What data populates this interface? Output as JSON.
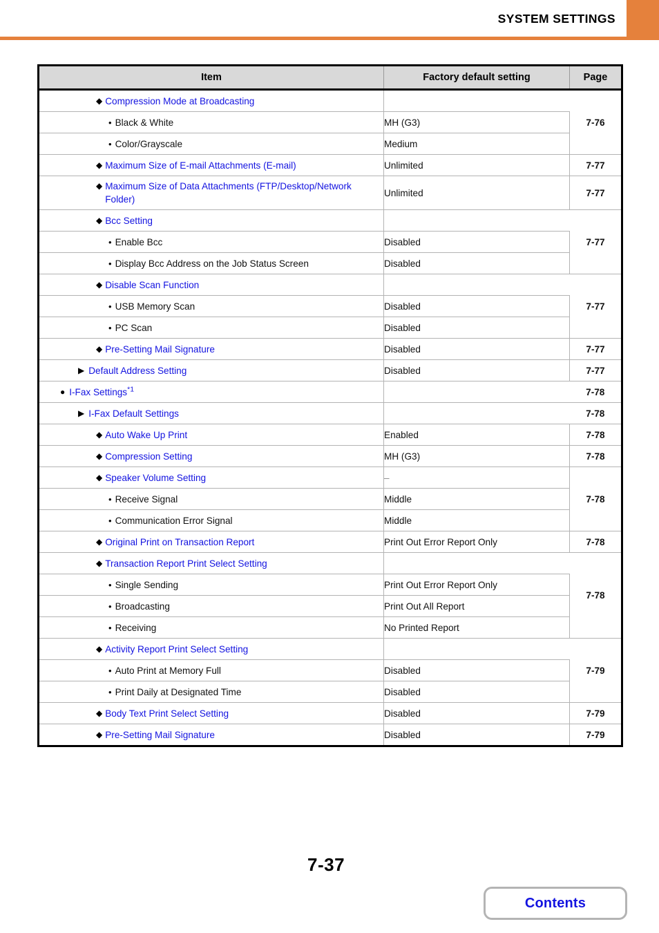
{
  "header": {
    "title": "SYSTEM SETTINGS",
    "accent_color": "#e5813c"
  },
  "table": {
    "columns": {
      "item": "Item",
      "value": "Factory default setting",
      "page": "Page"
    },
    "link_color": "#1313e0",
    "rows": [
      {
        "level": 3,
        "marker": "diamond",
        "label": "Compression Mode at Broadcasting",
        "link": true,
        "value": "",
        "value_blank": true,
        "page": "7-76",
        "page_rowspan": 3
      },
      {
        "level": 4,
        "marker": "bullet",
        "label": "Black & White",
        "link": false,
        "value": "MH (G3)",
        "page": null
      },
      {
        "level": 4,
        "marker": "bullet",
        "label": "Color/Grayscale",
        "link": false,
        "value": "Medium",
        "page": null
      },
      {
        "level": 3,
        "marker": "diamond",
        "label": "Maximum Size of E-mail Attachments (E-mail)",
        "link": true,
        "value": "Unlimited",
        "page": "7-77",
        "page_rowspan": 1
      },
      {
        "level": 3,
        "marker": "diamond",
        "label": "Maximum Size of Data Attachments (FTP/Desktop/Network Folder)",
        "link": true,
        "value": "Unlimited",
        "page": "7-77",
        "page_rowspan": 1,
        "tall": true
      },
      {
        "level": 3,
        "marker": "diamond",
        "label": "Bcc Setting",
        "link": true,
        "value": "",
        "value_blank": true,
        "page": "7-77",
        "page_rowspan": 3
      },
      {
        "level": 4,
        "marker": "bullet",
        "label": "Enable Bcc",
        "link": false,
        "value": "Disabled",
        "page": null
      },
      {
        "level": 4,
        "marker": "bullet",
        "label": "Display Bcc Address on the Job Status Screen",
        "link": false,
        "value": "Disabled",
        "page": null
      },
      {
        "level": 3,
        "marker": "diamond",
        "label": "Disable Scan Function",
        "link": true,
        "value": "",
        "value_blank": true,
        "page": "7-77",
        "page_rowspan": 3
      },
      {
        "level": 4,
        "marker": "bullet",
        "label": "USB Memory Scan",
        "link": false,
        "value": "Disabled",
        "page": null
      },
      {
        "level": 4,
        "marker": "bullet",
        "label": "PC Scan",
        "link": false,
        "value": "Disabled",
        "page": null
      },
      {
        "level": 3,
        "marker": "diamond",
        "label": "Pre-Setting Mail Signature",
        "link": true,
        "value": "Disabled",
        "page": "7-77",
        "page_rowspan": 1
      },
      {
        "level": 2,
        "marker": "triangle",
        "label": "Default Address Setting",
        "link": true,
        "value": "Disabled",
        "page": "7-77",
        "page_rowspan": 1
      },
      {
        "level": 1,
        "marker": "circle",
        "label": "I-Fax Settings",
        "sup": "*1",
        "link": true,
        "value": "",
        "value_blank": true,
        "page": "7-78",
        "page_rowspan": 1
      },
      {
        "level": 2,
        "marker": "triangle",
        "label": "I-Fax Default Settings",
        "link": true,
        "value": "",
        "value_blank": true,
        "page": "7-78",
        "page_rowspan": 1
      },
      {
        "level": 3,
        "marker": "diamond",
        "label": "Auto Wake Up Print",
        "link": true,
        "value": "Enabled",
        "page": "7-78",
        "page_rowspan": 1
      },
      {
        "level": 3,
        "marker": "diamond",
        "label": "Compression Setting",
        "link": true,
        "value": "MH (G3)",
        "page": "7-78",
        "page_rowspan": 1
      },
      {
        "level": 3,
        "marker": "diamond",
        "label": "Speaker Volume Setting",
        "link": true,
        "value": "–",
        "value_dash": true,
        "page": "7-78",
        "page_rowspan": 3
      },
      {
        "level": 4,
        "marker": "bullet",
        "label": "Receive Signal",
        "link": false,
        "value": "Middle",
        "page": null
      },
      {
        "level": 4,
        "marker": "bullet",
        "label": "Communication Error Signal",
        "link": false,
        "value": "Middle",
        "page": null
      },
      {
        "level": 3,
        "marker": "diamond",
        "label": "Original Print on Transaction Report",
        "link": true,
        "value": "Print Out Error Report Only",
        "page": "7-78",
        "page_rowspan": 1
      },
      {
        "level": 3,
        "marker": "diamond",
        "label": "Transaction Report Print Select Setting",
        "link": true,
        "value": "",
        "value_blank": true,
        "page": "7-78",
        "page_rowspan": 4
      },
      {
        "level": 4,
        "marker": "bullet",
        "label": "Single Sending",
        "link": false,
        "value": "Print Out Error Report Only",
        "page": null
      },
      {
        "level": 4,
        "marker": "bullet",
        "label": "Broadcasting",
        "link": false,
        "value": "Print Out All Report",
        "page": null
      },
      {
        "level": 4,
        "marker": "bullet",
        "label": "Receiving",
        "link": false,
        "value": "No Printed Report",
        "page": null
      },
      {
        "level": 3,
        "marker": "diamond",
        "label": "Activity Report Print Select Setting",
        "link": true,
        "value": "",
        "value_blank": true,
        "page": "7-79",
        "page_rowspan": 3
      },
      {
        "level": 4,
        "marker": "bullet",
        "label": "Auto Print at Memory Full",
        "link": false,
        "value": "Disabled",
        "page": null
      },
      {
        "level": 4,
        "marker": "bullet",
        "label": "Print Daily at Designated Time",
        "link": false,
        "value": "Disabled",
        "page": null
      },
      {
        "level": 3,
        "marker": "diamond",
        "label": "Body Text Print Select Setting",
        "link": true,
        "value": "Disabled",
        "page": "7-79",
        "page_rowspan": 1
      },
      {
        "level": 3,
        "marker": "diamond",
        "label": "Pre-Setting Mail Signature",
        "link": true,
        "value": "Disabled",
        "page": "7-79",
        "page_rowspan": 1
      }
    ]
  },
  "footer": {
    "page_number": "7-37",
    "contents_label": "Contents"
  },
  "markers": {
    "circle": "●",
    "triangle": "▶",
    "diamond": "◆",
    "bullet": "•"
  }
}
